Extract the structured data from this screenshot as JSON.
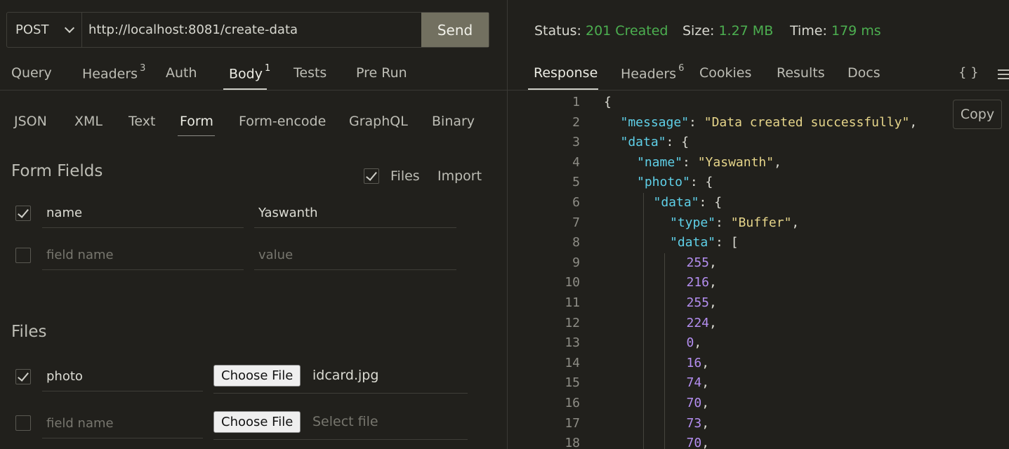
{
  "request": {
    "method": "POST",
    "url": "http://localhost:8081/create-data",
    "send_label": "Send",
    "tabs": [
      {
        "label": "Query",
        "count": ""
      },
      {
        "label": "Headers",
        "count": "3"
      },
      {
        "label": "Auth",
        "count": ""
      },
      {
        "label": "Body",
        "count": "1"
      },
      {
        "label": "Tests",
        "count": ""
      },
      {
        "label": "Pre Run",
        "count": ""
      }
    ],
    "active_tab": "Body",
    "body_tabs": [
      "JSON",
      "XML",
      "Text",
      "Form",
      "Form-encode",
      "GraphQL",
      "Binary"
    ],
    "active_body_tab": "Form"
  },
  "form": {
    "title": "Form Fields",
    "files_toggle_label": "Files",
    "import_label": "Import",
    "rows": [
      {
        "checked": true,
        "name": "name",
        "value": "Yaswanth"
      },
      {
        "checked": false,
        "name_placeholder": "field name",
        "value_placeholder": "value"
      }
    ]
  },
  "files": {
    "title": "Files",
    "choose_label": "Choose File",
    "rows": [
      {
        "checked": true,
        "name": "photo",
        "file": "idcard.jpg"
      },
      {
        "checked": false,
        "name_placeholder": "field name",
        "file_placeholder": "Select file"
      }
    ]
  },
  "response": {
    "status_label": "Status:",
    "status_value": "201 Created",
    "size_label": "Size:",
    "size_value": "1.27 MB",
    "time_label": "Time:",
    "time_value": "179 ms",
    "tabs": [
      {
        "label": "Response",
        "count": ""
      },
      {
        "label": "Headers",
        "count": "6"
      },
      {
        "label": "Cookies",
        "count": ""
      },
      {
        "label": "Results",
        "count": ""
      },
      {
        "label": "Docs",
        "count": ""
      }
    ],
    "active_tab": "Response",
    "braces_label": "{ }",
    "copy_label": "Copy",
    "colors": {
      "status_ok": "#4caf50",
      "key": "#5fd0e8",
      "string": "#e6d58a",
      "number": "#b48ef0"
    },
    "code_lines": [
      {
        "n": "1",
        "indent": 0,
        "parts": [
          {
            "t": "p",
            "v": "{"
          }
        ]
      },
      {
        "n": "2",
        "indent": 1,
        "parts": [
          {
            "t": "k",
            "v": "\"message\""
          },
          {
            "t": "p",
            "v": ": "
          },
          {
            "t": "s",
            "v": "\"Data created successfully\""
          },
          {
            "t": "p",
            "v": ","
          }
        ]
      },
      {
        "n": "3",
        "indent": 1,
        "parts": [
          {
            "t": "k",
            "v": "\"data\""
          },
          {
            "t": "p",
            "v": ": {"
          }
        ]
      },
      {
        "n": "4",
        "indent": 2,
        "parts": [
          {
            "t": "k",
            "v": "\"name\""
          },
          {
            "t": "p",
            "v": ": "
          },
          {
            "t": "s",
            "v": "\"Yaswanth\""
          },
          {
            "t": "p",
            "v": ","
          }
        ]
      },
      {
        "n": "5",
        "indent": 2,
        "parts": [
          {
            "t": "k",
            "v": "\"photo\""
          },
          {
            "t": "p",
            "v": ": {"
          }
        ]
      },
      {
        "n": "6",
        "indent": 3,
        "parts": [
          {
            "t": "k",
            "v": "\"data\""
          },
          {
            "t": "p",
            "v": ": {"
          }
        ]
      },
      {
        "n": "7",
        "indent": 4,
        "parts": [
          {
            "t": "k",
            "v": "\"type\""
          },
          {
            "t": "p",
            "v": ": "
          },
          {
            "t": "s",
            "v": "\"Buffer\""
          },
          {
            "t": "p",
            "v": ","
          }
        ]
      },
      {
        "n": "8",
        "indent": 4,
        "parts": [
          {
            "t": "k",
            "v": "\"data\""
          },
          {
            "t": "p",
            "v": ": ["
          }
        ]
      },
      {
        "n": "9",
        "indent": 5,
        "parts": [
          {
            "t": "n",
            "v": "255"
          },
          {
            "t": "p",
            "v": ","
          }
        ]
      },
      {
        "n": "10",
        "indent": 5,
        "parts": [
          {
            "t": "n",
            "v": "216"
          },
          {
            "t": "p",
            "v": ","
          }
        ]
      },
      {
        "n": "11",
        "indent": 5,
        "parts": [
          {
            "t": "n",
            "v": "255"
          },
          {
            "t": "p",
            "v": ","
          }
        ]
      },
      {
        "n": "12",
        "indent": 5,
        "parts": [
          {
            "t": "n",
            "v": "224"
          },
          {
            "t": "p",
            "v": ","
          }
        ]
      },
      {
        "n": "13",
        "indent": 5,
        "parts": [
          {
            "t": "n",
            "v": "0"
          },
          {
            "t": "p",
            "v": ","
          }
        ]
      },
      {
        "n": "14",
        "indent": 5,
        "parts": [
          {
            "t": "n",
            "v": "16"
          },
          {
            "t": "p",
            "v": ","
          }
        ]
      },
      {
        "n": "15",
        "indent": 5,
        "parts": [
          {
            "t": "n",
            "v": "74"
          },
          {
            "t": "p",
            "v": ","
          }
        ]
      },
      {
        "n": "16",
        "indent": 5,
        "parts": [
          {
            "t": "n",
            "v": "70"
          },
          {
            "t": "p",
            "v": ","
          }
        ]
      },
      {
        "n": "17",
        "indent": 5,
        "parts": [
          {
            "t": "n",
            "v": "73"
          },
          {
            "t": "p",
            "v": ","
          }
        ]
      },
      {
        "n": "18",
        "indent": 5,
        "parts": [
          {
            "t": "n",
            "v": "70"
          },
          {
            "t": "p",
            "v": ","
          }
        ]
      }
    ]
  }
}
